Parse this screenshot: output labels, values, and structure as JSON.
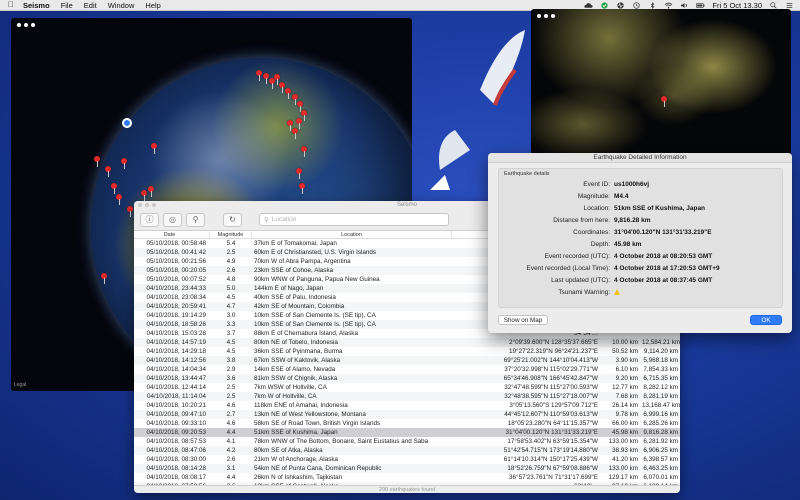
{
  "menubar": {
    "app": "Seismo",
    "items": [
      "File",
      "Edit",
      "Window",
      "Help"
    ],
    "clock": "Fri 5 Oct  13.30"
  },
  "globe_window": {
    "legal": "Legal"
  },
  "list_window": {
    "title": "Seismo",
    "search_placeholder": "Location",
    "columns": [
      "Date",
      "Magnitude",
      "Location",
      "",
      "",
      ""
    ],
    "footer": "290 earthquakes found",
    "rows": [
      [
        "05/10/2018, 00:58:48",
        "5.4",
        "37km E of Tomakomai, Japan",
        "42°37'…",
        "",
        ""
      ],
      [
        "05/10/2018, 00:41:42",
        "2.5",
        "60km E of Christiansted, U.S. Virgin Islands",
        "17°40'…",
        "",
        ""
      ],
      [
        "05/10/2018, 00:21:56",
        "4.9",
        "70km W of Abra Pampa, Argentina",
        "22°50'…",
        "",
        ""
      ],
      [
        "05/10/2018, 00:20:05",
        "2.6",
        "23km SSE of Cohoe, Alaska",
        "60°09'…",
        "",
        ""
      ],
      [
        "05/10/2018, 00:07:52",
        "4.8",
        "90km WNW of Panguna, Papua New Guinea",
        "5°57'3…",
        "",
        ""
      ],
      [
        "04/10/2018, 23:44:33",
        "5.0",
        "144km E of Nago, Japan",
        "26°34'…",
        "",
        ""
      ],
      [
        "04/10/2018, 23:08:34",
        "4.5",
        "40km SSE of Palu, Indonesia",
        "1°12'1…",
        "",
        ""
      ],
      [
        "04/10/2018, 20:59:41",
        "4.7",
        "42km SE of Mountain, Colombia",
        "13°04'…",
        "",
        ""
      ],
      [
        "04/10/2018, 19:14:29",
        "3.0",
        "10km SSE of San Clemente Is. (SE tip), CA",
        "32°49'…",
        "",
        ""
      ],
      [
        "04/10/2018, 18:58:26",
        "3.3",
        "10km SSE of San Clemente Is. (SE tip), CA",
        "32°49'…",
        "",
        ""
      ],
      [
        "04/10/2018, 15:03:28",
        "3.7",
        "88km E of Chernabura Island, Alaska",
        "54°54'…",
        "",
        ""
      ],
      [
        "04/10/2018, 14:57:19",
        "4.5",
        "80km NE of Tobelo, Indonesia",
        "2°09'39.600\"N 128°35'37.665\"E",
        "10.00 km",
        "12,584.21 km"
      ],
      [
        "04/10/2018, 14:29:18",
        "4.5",
        "36km SSE of Pyinmana, Burma",
        "19°27'22.319\"N 96°24'21.237\"E",
        "50.52 km",
        "9,114.20 km"
      ],
      [
        "04/10/2018, 14:12:56",
        "3.8",
        "67km SSW of Kaktovik, Alaska",
        "69°25'21.002\"N 144°10'04.413\"W",
        "3.90 km",
        "5,968.18 km"
      ],
      [
        "04/10/2018, 14:04:34",
        "2.9",
        "14km ESE of Alamo, Nevada",
        "37°20'32.998\"N 115°02'29.771\"W",
        "6.10 km",
        "7,854.33 km"
      ],
      [
        "04/10/2018, 13:44:47",
        "3.6",
        "81km SSW of Chignik, Alaska",
        "65°34'46.908\"N 166°45'42.847\"W",
        "9.20 km",
        "6,715.35 km"
      ],
      [
        "04/10/2018, 12:44:14",
        "2.5",
        "7km WSW of Holtville, CA",
        "32°47'48.599\"N 115°27'00.593\"W",
        "12.77 km",
        "8,282.12 km"
      ],
      [
        "04/10/2018, 11:14:04",
        "2.5",
        "7km W of Holtville, CA",
        "32°48'38.595\"N 115°27'18.007\"W",
        "7.68 km",
        "8,281.19 km"
      ],
      [
        "04/10/2018, 10:20:21",
        "4.6",
        "118km ENE of Amahai, Indonesia",
        "3°05'13.560\"S 129°57'09.712\"E",
        "26.14 km",
        "13,168.47 km"
      ],
      [
        "04/10/2018, 09:47:10",
        "2.7",
        "13km NE of West Yellowstone, Montana",
        "44°45'12.607\"N 110°59'03.613\"W",
        "9.78 km",
        "6,999.16 km"
      ],
      [
        "04/10/2018, 09:33:10",
        "4.6",
        "58km SE of Road Town, British Virgin Islands",
        "18°05'23.280\"N 64°11'15.357\"W",
        "66.00 km",
        "6,285.26 km"
      ],
      [
        "04/10/2018, 09:20:53",
        "4.4",
        "51km SSE of Kushima, Japan",
        "31°04'00.120\"N 131°31'33.219\"E",
        "45.98 km",
        "9,816.28 km"
      ],
      [
        "04/10/2018, 08:57:53",
        "4.1",
        "78km WNW of The Bottom, Bonaire, Saint Eustatius and Saba",
        "17°58'53.402\"N 63°59'15.354\"W",
        "133.00 km",
        "6,281.92 km"
      ],
      [
        "04/10/2018, 08:47:06",
        "4.2",
        "80km SE of Atka, Alaska",
        "51°42'54.715\"N 173°19'14.880\"W",
        "38.93 km",
        "6,906.25 km"
      ],
      [
        "04/10/2018, 08:30:00",
        "2.6",
        "21km W of Anchorage, Alaska",
        "61°14'10.314\"N 150°17'25.439\"W",
        "41.20 km",
        "6,398.57 km"
      ],
      [
        "04/10/2018, 08:14:28",
        "3.1",
        "54km NE of Punta Cana, Dominican Republic",
        "18°52'26.759\"N 67°59'08.886\"W",
        "133.00 km",
        "6,463.25 km"
      ],
      [
        "04/10/2018, 08:08:17",
        "4.4",
        "26km N of Ishkashim, Tajikistan",
        "36°57'23.761\"N 71°31'17.699\"E",
        "129.17 km",
        "6,070.01 km"
      ],
      [
        "04/10/2018, 07:58:56",
        "2.6",
        "18km SSE of Cantwell, Alaska",
        "63°10'…",
        "97.10 km",
        "6,188.14 km"
      ]
    ],
    "selected_index": 21
  },
  "detail_window": {
    "title": "Earthquake Detailed Information",
    "box_title": "Earthquake details",
    "fields": [
      {
        "label": "Event ID:",
        "value": "us1000h6vj"
      },
      {
        "label": "Magnitude:",
        "value": "M4.4"
      },
      {
        "label": "Location:",
        "value": "51km SSE of Kushima, Japan"
      },
      {
        "label": "Distance from here:",
        "value": "9,816.28 km"
      },
      {
        "label": "Coordinates:",
        "value": "31°04'00.120\"N 131°31'33.219\"E"
      },
      {
        "label": "Depth:",
        "value": "45.98 km"
      },
      {
        "label": "Event recorded (UTC):",
        "value": "4 October 2018 at 08:20:53 GMT"
      },
      {
        "label": "Event recorded (Local Time):",
        "value": "4 October 2018 at 17:20:53 GMT+9"
      },
      {
        "label": "Last updated (UTC):",
        "value": "4 October 2018 at 08:37:45 GMT"
      },
      {
        "label": "Tsunami Warning:",
        "value": ""
      }
    ],
    "show_on_map": "Show on Map",
    "ok": "OK"
  }
}
